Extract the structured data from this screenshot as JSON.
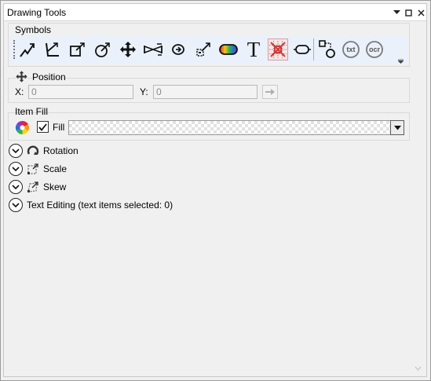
{
  "window": {
    "title": "Drawing Tools"
  },
  "titlebar": {
    "icons": [
      "pin-dropdown-icon",
      "maximize-icon",
      "close-icon"
    ]
  },
  "symbols": {
    "label": "Symbols",
    "tools": [
      "polyline-tool-icon",
      "angle-tool-icon",
      "callout-box-tool-icon",
      "arc-callout-tool-icon",
      "move-tool-icon",
      "line-tool-icon",
      "rotate-object-tool-icon",
      "resize-tool-icon",
      "color-bar-tool-icon",
      "text-tool-icon",
      "grid-select-tool-icon",
      "pill-shape-tool-icon",
      "shape-connector-tool-icon",
      "text-recognition-tool-icon",
      "ocr-tool-icon"
    ],
    "text_tool_glyph": "T",
    "txt_badge": "txt",
    "ocr_badge": "ocr"
  },
  "position": {
    "label": "Position",
    "x_label": "X:",
    "x_value": "0",
    "y_label": "Y:",
    "y_value": "0"
  },
  "item_fill": {
    "label": "Item Fill",
    "fill_label": "Fill",
    "fill_checked": true
  },
  "sections": [
    {
      "label": "Rotation",
      "icon": "rotation-icon"
    },
    {
      "label": "Scale",
      "icon": "scale-icon"
    },
    {
      "label": "Skew",
      "icon": "skew-icon"
    },
    {
      "label": "Text Editing (text items selected: 0)",
      "icon": null
    }
  ],
  "colors": {
    "accent_blue": "#1f5fa8",
    "toolbar_bg": "#eaf1fb",
    "panel_bg": "#f0f0f0",
    "tool_red": "#d23c3c"
  }
}
